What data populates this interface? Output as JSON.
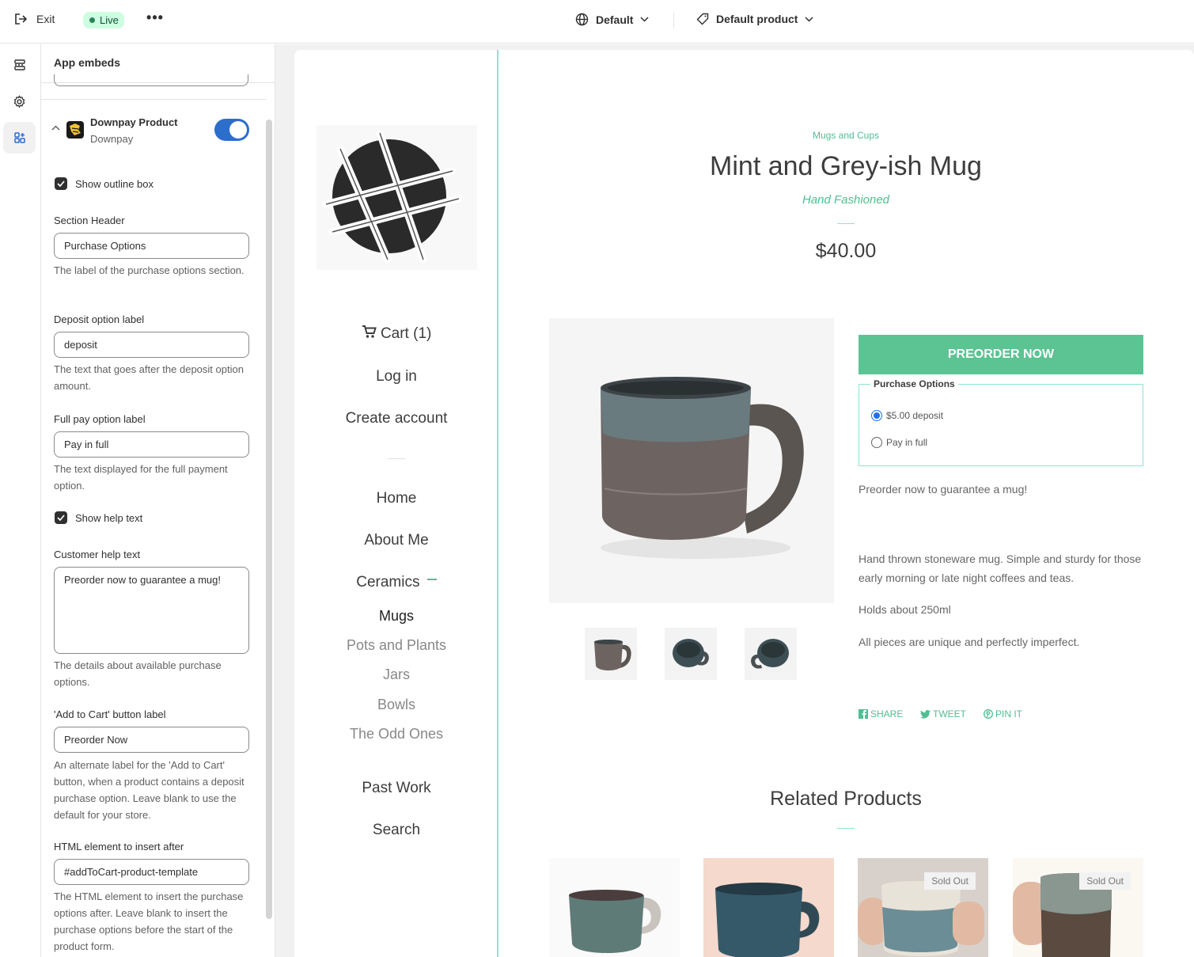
{
  "topbar": {
    "exit_label": "Exit",
    "status_badge": "Live",
    "more_label": "•••",
    "theme_select": "Default",
    "template_select": "Default product"
  },
  "panel": {
    "title": "App embeds",
    "app": {
      "name": "Downpay Product",
      "vendor": "Downpay",
      "enabled": true
    },
    "show_outline_label": "Show outline box",
    "section_header": {
      "label": "Section Header",
      "value": "Purchase Options",
      "help": "The label of the purchase options section."
    },
    "deposit_label": {
      "label": "Deposit option label",
      "value": "deposit",
      "help": "The text that goes after the deposit option amount."
    },
    "full_pay_label": {
      "label": "Full pay option label",
      "value": "Pay in full",
      "help": "The text displayed for the full payment option."
    },
    "show_help_label": "Show help text",
    "customer_help": {
      "label": "Customer help text",
      "value": "Preorder now to guarantee a mug!",
      "help": "The details about available purchase options."
    },
    "add_to_cart": {
      "label": "'Add to Cart' button label",
      "value": "Preorder Now",
      "help": "An alternate label for the 'Add to Cart' button, when a product contains a deposit purchase option. Leave blank to use the default for your store."
    },
    "html_element": {
      "label": "HTML element to insert after",
      "value": "#addToCart-product-template",
      "help": "The HTML element to insert the purchase options after. Leave blank to insert the purchase options before the start of the product form."
    }
  },
  "store": {
    "nav": {
      "cart": "Cart (1)",
      "login": "Log in",
      "create_account": "Create account",
      "home": "Home",
      "about": "About Me",
      "ceramics": "Ceramics",
      "mugs": "Mugs",
      "pots": "Pots and Plants",
      "jars": "Jars",
      "bowls": "Bowls",
      "odd": "The Odd Ones",
      "past_work": "Past Work",
      "search": "Search"
    },
    "product": {
      "collection": "Mugs and Cups",
      "title": "Mint and Grey-ish Mug",
      "vendor": "Hand Fashioned",
      "price": "$40.00",
      "button": "PREORDER NOW",
      "options_legend": "Purchase Options",
      "option_deposit": "$5.00 deposit",
      "option_full": "Pay in full",
      "help_text": "Preorder now to guarantee a mug!",
      "description": [
        "Hand thrown stoneware mug. Simple and sturdy for those early morning or late night coffees and teas.",
        "Holds about 250ml",
        "All pieces are unique and perfectly imperfect."
      ],
      "share": "SHARE",
      "tweet": "TWEET",
      "pin": "PIN IT"
    },
    "related": {
      "title": "Related Products",
      "sold_out": "Sold Out"
    }
  },
  "colors": {
    "accent": "#5cc393",
    "toggle": "#2c6ecb",
    "live_bg": "#cdfee1"
  }
}
